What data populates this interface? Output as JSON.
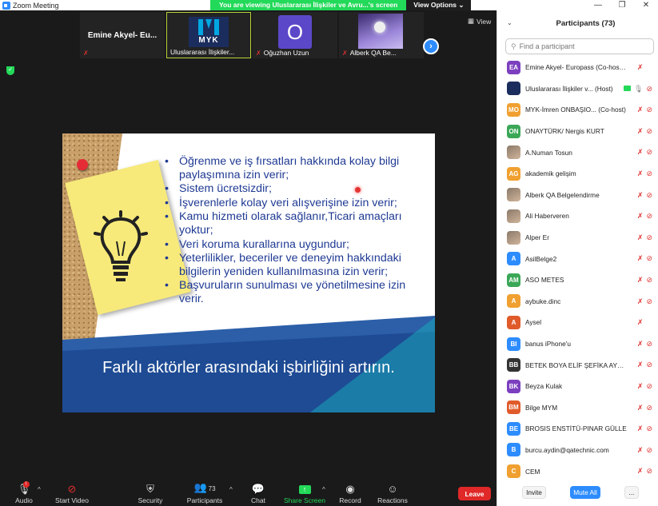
{
  "window": {
    "title": "Zoom Meeting"
  },
  "banner": {
    "message": "You are viewing Uluslararası İlişkiler ve Avru...'s screen",
    "options": "View Options"
  },
  "thumbnails": [
    {
      "name": "Emine Akyel- Eu...",
      "label": ""
    },
    {
      "name": "Uluslararası İlişkiler...",
      "logo_text": "MYK"
    },
    {
      "name": "Oğuzhan Uzun",
      "initial": "O"
    },
    {
      "name": "Alberk QA Be..."
    }
  ],
  "view_label": "View",
  "slide": {
    "bullets": [
      "Öğrenme ve iş fırsatları hakkında kolay bilgi paylaşımına izin verir;",
      "Sistem ücretsizdir;",
      "İşverenlerle kolay veri alışverişine izin verir;",
      "Kamu hizmeti olarak sağlanır,Ticari amaçları yoktur;",
      "Veri koruma kurallarına uygundur;",
      "Yeterlilikler, beceriler ve deneyim hakkındaki bilgilerin yeniden kullanılmasına izin verir;",
      "Başvuruların sunulması ve yönetilmesine izin verir."
    ],
    "bottom_text": "Farklı aktörler arasındaki işbirliğini artırın."
  },
  "toolbar": {
    "audio": "Audio",
    "audio_badge": "!",
    "video": "Start Video",
    "security": "Security",
    "participants": "Participants",
    "participants_count": "73",
    "chat": "Chat",
    "share": "Share Screen",
    "record": "Record",
    "reactions": "Reactions",
    "leave": "Leave"
  },
  "panel": {
    "title": "Participants (73)",
    "search_placeholder": "Find a participant",
    "participants": [
      {
        "initials": "EA",
        "name": "Emine Akyel- Europass (Co-host, me)",
        "color": "#7b3fbf",
        "cam": false
      },
      {
        "initials": "",
        "name": "Uluslararası İlişkiler v... (Host)",
        "color": "#1b2d5c",
        "host": true
      },
      {
        "initials": "MO",
        "name": "MYK-İmren ONBAŞIO... (Co-host)",
        "color": "#f0a030",
        "cam": true
      },
      {
        "initials": "ON",
        "name": " ONAYTÜRK/ Nergis KURT",
        "color": "#3aa757",
        "cam": true
      },
      {
        "initials": "",
        "name": "A.Numan Tosun",
        "color": "#8a7a6a",
        "photo": true,
        "cam": true
      },
      {
        "initials": "AG",
        "name": "akademik gelişim",
        "color": "#f0a030",
        "cam": true
      },
      {
        "initials": "",
        "name": "Alberk QA Belgelendirme",
        "color": "#6a55c0",
        "photo": true,
        "cam": true
      },
      {
        "initials": "",
        "name": "Ali Haberveren",
        "color": "#a08060",
        "photo": true,
        "cam": true
      },
      {
        "initials": "",
        "name": "Alper Er",
        "color": "#705848",
        "photo": true,
        "cam": true
      },
      {
        "initials": "A",
        "name": "AsilBelge2",
        "color": "#2d8cff",
        "cam": true
      },
      {
        "initials": "AM",
        "name": "ASO METES",
        "color": "#3aa757",
        "cam": true
      },
      {
        "initials": "A",
        "name": "aybuke.dinc",
        "color": "#f0a030",
        "cam": true
      },
      {
        "initials": "A",
        "name": "Aysel",
        "color": "#e05a2a",
        "cam": false
      },
      {
        "initials": "BI",
        "name": "banus iPhone'u",
        "color": "#2d8cff",
        "cam": true
      },
      {
        "initials": "BB",
        "name": "BETEK BOYA ELİF ŞEFİKA AYDEM...",
        "color": "#333333",
        "cam": true
      },
      {
        "initials": "BK",
        "name": "Beyza Kulak",
        "color": "#7b3fbf",
        "cam": true
      },
      {
        "initials": "BM",
        "name": "Bilge MYM",
        "color": "#e05a2a",
        "cam": true
      },
      {
        "initials": "BE",
        "name": "BROSIS ENSTİTÜ-PINAR GÜLLE",
        "color": "#2d8cff",
        "cam": true
      },
      {
        "initials": "B",
        "name": "burcu.aydin@qatechnic.com",
        "color": "#2d8cff",
        "cam": true
      },
      {
        "initials": "C",
        "name": "CEM",
        "color": "#f0a030",
        "cam": true
      }
    ],
    "invite": "Invite",
    "mute_all": "Mute All",
    "more": "..."
  }
}
